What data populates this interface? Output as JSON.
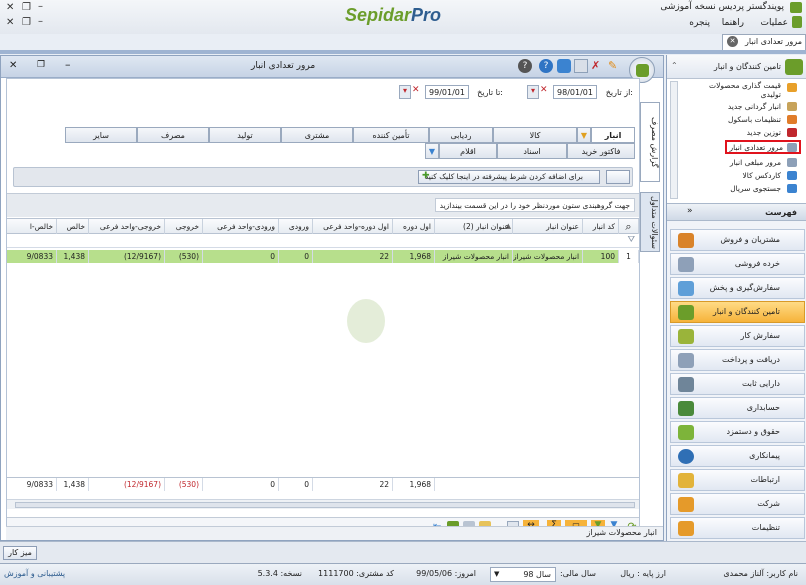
{
  "app": {
    "title": "پویندگستر پردیس نسخه آموزشی",
    "logo_part1": "Sepidar",
    "logo_part2": "Pro",
    "menu": [
      "عملیات",
      "راهنما",
      "پنجره"
    ],
    "doc_tab": "مرور تعدادی انبار"
  },
  "window": {
    "title": "مرور تعدادی انبار",
    "vertical_tabs": [
      "گزارش مصرف",
      "سئوالات متداول"
    ]
  },
  "filter": {
    "from_label": "از تاریخ:",
    "from_value": "98/01/01",
    "to_label": "تا تاریخ:",
    "to_value": "99/01/01"
  },
  "tabs_row1": [
    "انبار",
    "کالا",
    "ردیابی",
    "تأمین کننده",
    "مشتری",
    "تولید",
    "مصرف",
    "سایر"
  ],
  "tabs_row2": [
    "فاکتور خرید",
    "اسناد",
    "اقلام"
  ],
  "advanced_filter_hint": "برای اضافه کردن شرط پیشرفته در اینجا کلیک کنید",
  "group_hint": "جهت گروهبندی ستون موردنظر خود را در این قسمت بیندازید",
  "table": {
    "headers": [
      "کد انبار",
      "عنوان انبار",
      "عنوان انبار (2)",
      "اول دوره",
      "اول دوره-واحد فرعی",
      "ورودی",
      "ورودی-واحد فرعی",
      "خروجی",
      "خروجی-واحد فرعی",
      "خالص",
      "خالص-ا"
    ],
    "row": {
      "index": "1",
      "code": "100",
      "title": "انبار محصولات شیراز",
      "title2": "انبار محصولات شیراز",
      "opening": "1,968",
      "opening_sub": "22",
      "input": "0",
      "input_sub": "0",
      "output": "(530)",
      "output_sub": "(12/9167)",
      "net": "1,438",
      "net_sub": "9/0833"
    },
    "totals": {
      "opening": "1,968",
      "opening_sub": "22",
      "input": "0",
      "input_sub": "0",
      "output": "(530)",
      "output_sub": "(12/9167)",
      "net": "1,438",
      "net_sub": "9/0833"
    },
    "footer_warehouse": "انبار محصولات شیراز"
  },
  "sidebar": {
    "section_title": "تامین کنندگان و انبار",
    "items": [
      "قیمت گذاری محصولات تولیدی",
      "انبار گردانی جدید",
      "تنظیمات باسکول",
      "توزین جدید",
      "مرور تعدادی انبار",
      "مرور مبلغی انبار",
      "کاردکس کالا",
      "جستجوی سریال"
    ],
    "list_header": "فهرست",
    "nav": [
      "مشتریان و فروش",
      "خرده فروشی",
      "سفارش‌گیری و پخش",
      "تامین کنندگان و انبار",
      "سفارش کار",
      "دریافت و پرداخت",
      "دارایی ثابت",
      "حسابداری",
      "حقوق و دستمزد",
      "پیمانکاری",
      "ارتباطات",
      "شرکت",
      "تنظیمات"
    ]
  },
  "taskbar": {
    "item": "میز کار"
  },
  "status": {
    "user": "نام کاربر: آلناز محمدی",
    "base_currency": "ارز پایه : ریال",
    "fiscal_year_label": "سال مالی:",
    "fiscal_year_value": "سال 98",
    "today": "امروز: 99/05/06",
    "customer_code": "کد مشتری: 1111700",
    "version": "نسخه: 5.3.4",
    "support": "پشتیبانی و آموزش"
  },
  "colors": {
    "accent": "#2e5d8f",
    "highlight_row": "#b7df8c",
    "active_nav": "#f6b33a",
    "red_value": "#c0272d"
  }
}
